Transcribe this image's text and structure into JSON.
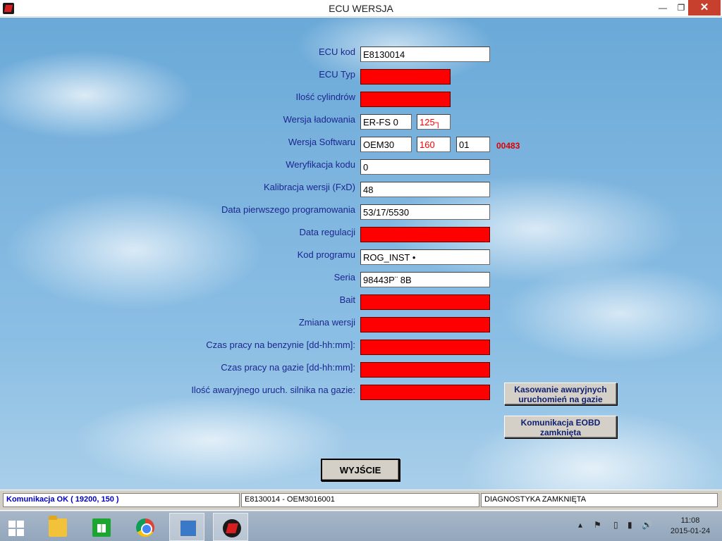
{
  "window": {
    "title": "ECU WERSJA",
    "minimize_glyph": "—",
    "maximize_glyph": "❐",
    "close_glyph": "✕",
    "app_icon": "app-logo-icon"
  },
  "form": {
    "rows": [
      {
        "label": "ECU kod",
        "value": "E8130014"
      },
      {
        "label": "ECU Typ",
        "value": ""
      },
      {
        "label": "Ilość cylindrów",
        "value": ""
      },
      {
        "label": "Wersja ładowania",
        "value": "ER-FS 0",
        "value2": "125┐"
      },
      {
        "label": "Wersja Softwaru",
        "value": "OEM30",
        "value2": "160",
        "value3": "01",
        "extra": "00483"
      },
      {
        "label": "Weryfikacja kodu",
        "value": "0"
      },
      {
        "label": "Kalibracja wersji (FxD)",
        "value": "48"
      },
      {
        "label": "Data pierwszego programowania",
        "value": "53/17/5530"
      },
      {
        "label": "Data regulacji",
        "value": ""
      },
      {
        "label": "Kod programu",
        "value": "ROG_INST •"
      },
      {
        "label": "Seria",
        "value": "98443P¨ 8B"
      },
      {
        "label": "Bait",
        "value": ""
      },
      {
        "label": "Zmiana wersji",
        "value": ""
      },
      {
        "label": "Czas pracy na benzynie [dd-hh:mm]:",
        "value": ""
      },
      {
        "label": "Czas pracy na gazie [dd-hh:mm]:",
        "value": ""
      },
      {
        "label": "Ilość awaryjnego uruch. silnika na gazie:",
        "value": ""
      }
    ],
    "field_error_color": "#ff0000"
  },
  "buttons": {
    "reset_emergency": "Kasowanie awaryjnych uruchomień na gazie",
    "eobd": "Komunikacja EOBD zamknięta",
    "exit": "WYJŚCIE"
  },
  "statusbar": {
    "comm": "Komunikacja OK ( 19200,  150 )",
    "ecu": "E8130014 - OEM3016001",
    "diag": "DIAGNOSTYKA ZAMKNIĘTA"
  },
  "taskbar": {
    "items": [
      "windows-start-icon",
      "file-explorer-icon",
      "store-icon",
      "chrome-icon",
      "remote-pc-icon",
      "diagnostic-app-icon"
    ],
    "tray": {
      "flag_icon": "⚑",
      "battery_icon": "▯",
      "signal_icon": "▮",
      "volume_icon": "🔊"
    },
    "clock_time": "11:08",
    "clock_date": "2015-01-24"
  }
}
